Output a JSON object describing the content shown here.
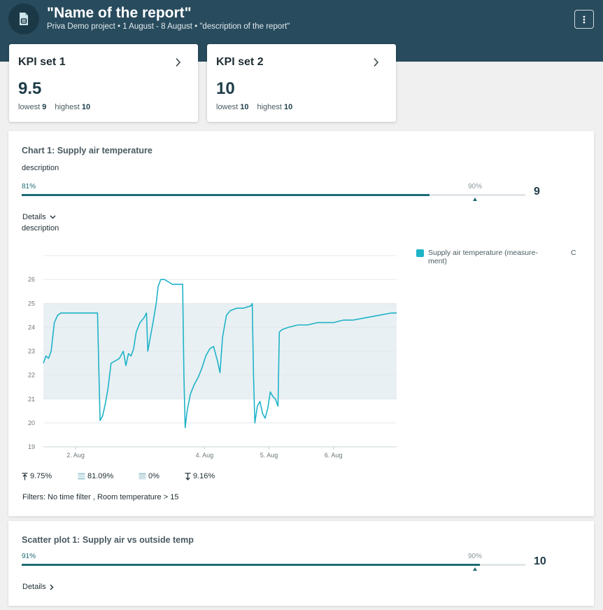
{
  "header": {
    "title": "\"Name of the report\"",
    "subtitle": "Priva Demo project • 1 August - 8 August • \"description of the report\"",
    "report_icon": "report-icon",
    "menu_icon": "more-vertical-icon"
  },
  "kpis": [
    {
      "title": "KPI set 1",
      "value": "9.5",
      "lowest_label": "lowest",
      "lowest": "9",
      "highest_label": "highest",
      "highest": "10"
    },
    {
      "title": "KPI set 2",
      "value": "10",
      "lowest_label": "lowest",
      "lowest": "10",
      "highest_label": "highest",
      "highest": "10"
    }
  ],
  "chart_panel": {
    "title": "Chart 1: Supply air temperature",
    "description": "description",
    "progress": {
      "value_label": "81%",
      "value": 81,
      "target_label": "90%",
      "target": 90,
      "score": "9"
    },
    "details_label": "Details",
    "details_description": "description",
    "legend_label": "Supply air temperature (measure-ment)",
    "legend_unit": "C",
    "stats": {
      "above": "9.75%",
      "within": "81.09%",
      "missing": "0%",
      "below": "9.16%"
    },
    "filters": "Filters: No time filter , Room temperature > 15"
  },
  "scatter_panel": {
    "title": "Scatter plot 1: Supply air vs outside temp",
    "progress": {
      "value_label": "91%",
      "value": 91,
      "target_label": "90%",
      "target": 90,
      "score": "10"
    },
    "details_label": "Details"
  },
  "colors": {
    "header": "#284b5d",
    "accent": "#1e6b76",
    "line": "#1fb3c8",
    "band": "#e8f0f3"
  },
  "chart_data": {
    "type": "line",
    "title": "",
    "xlabel": "",
    "ylabel": "",
    "x_tick_labels": [
      "2. Aug",
      "4. Aug",
      "5. Aug",
      "6. Aug"
    ],
    "x_ticks": [
      2,
      4,
      5,
      6
    ],
    "x_range": [
      1.5,
      6.98
    ],
    "ylim": [
      19,
      27
    ],
    "y_ticks": [
      19,
      20,
      21,
      22,
      23,
      24,
      25,
      26
    ],
    "comfort_band": [
      21,
      25
    ],
    "grid": "horizontal",
    "legend_position": "right",
    "series": [
      {
        "name": "Supply air temperature (measurement)",
        "points": [
          [
            1.5,
            22.5
          ],
          [
            1.54,
            22.8
          ],
          [
            1.58,
            22.7
          ],
          [
            1.62,
            23.0
          ],
          [
            1.67,
            24.2
          ],
          [
            1.72,
            24.5
          ],
          [
            1.77,
            24.6
          ],
          [
            1.9,
            24.6
          ],
          [
            2.2,
            24.6
          ],
          [
            2.34,
            24.6
          ],
          [
            2.36,
            22.2
          ],
          [
            2.38,
            20.1
          ],
          [
            2.42,
            20.3
          ],
          [
            2.46,
            20.8
          ],
          [
            2.5,
            21.4
          ],
          [
            2.55,
            22.5
          ],
          [
            2.62,
            22.6
          ],
          [
            2.68,
            22.7
          ],
          [
            2.74,
            23.0
          ],
          [
            2.78,
            22.4
          ],
          [
            2.82,
            22.9
          ],
          [
            2.86,
            22.8
          ],
          [
            2.9,
            23.1
          ],
          [
            2.94,
            23.8
          ],
          [
            3.0,
            24.2
          ],
          [
            3.06,
            24.4
          ],
          [
            3.1,
            24.6
          ],
          [
            3.12,
            23.0
          ],
          [
            3.16,
            23.6
          ],
          [
            3.2,
            24.2
          ],
          [
            3.25,
            25.0
          ],
          [
            3.28,
            25.7
          ],
          [
            3.32,
            26.0
          ],
          [
            3.38,
            26.0
          ],
          [
            3.44,
            25.9
          ],
          [
            3.5,
            25.8
          ],
          [
            3.58,
            25.8
          ],
          [
            3.66,
            25.8
          ],
          [
            3.68,
            22.0
          ],
          [
            3.7,
            19.8
          ],
          [
            3.73,
            20.5
          ],
          [
            3.78,
            21.2
          ],
          [
            3.84,
            21.6
          ],
          [
            3.9,
            21.9
          ],
          [
            3.96,
            22.3
          ],
          [
            4.02,
            22.8
          ],
          [
            4.08,
            23.1
          ],
          [
            4.14,
            23.2
          ],
          [
            4.2,
            22.6
          ],
          [
            4.24,
            22.1
          ],
          [
            4.28,
            23.6
          ],
          [
            4.34,
            24.5
          ],
          [
            4.4,
            24.7
          ],
          [
            4.5,
            24.8
          ],
          [
            4.6,
            24.8
          ],
          [
            4.72,
            24.9
          ],
          [
            4.74,
            25.0
          ],
          [
            4.76,
            22.0
          ],
          [
            4.78,
            20.0
          ],
          [
            4.82,
            20.7
          ],
          [
            4.86,
            20.9
          ],
          [
            4.9,
            20.4
          ],
          [
            4.94,
            20.2
          ],
          [
            4.98,
            20.6
          ],
          [
            5.02,
            21.3
          ],
          [
            5.06,
            21.1
          ],
          [
            5.1,
            21.0
          ],
          [
            5.14,
            20.7
          ],
          [
            5.16,
            23.8
          ],
          [
            5.2,
            23.9
          ],
          [
            5.3,
            24.0
          ],
          [
            5.45,
            24.1
          ],
          [
            5.6,
            24.1
          ],
          [
            5.75,
            24.2
          ],
          [
            5.9,
            24.2
          ],
          [
            6.0,
            24.2
          ],
          [
            6.15,
            24.3
          ],
          [
            6.3,
            24.3
          ],
          [
            6.5,
            24.4
          ],
          [
            6.7,
            24.5
          ],
          [
            6.9,
            24.6
          ],
          [
            6.98,
            24.6
          ]
        ]
      }
    ]
  }
}
